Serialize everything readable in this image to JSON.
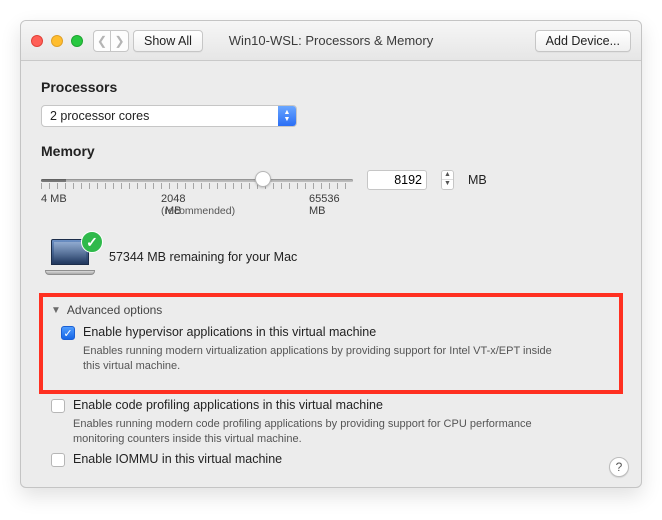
{
  "window": {
    "title": "Win10-WSL: Processors & Memory",
    "show_all_label": "Show All",
    "add_device_label": "Add Device..."
  },
  "processors": {
    "section_title": "Processors",
    "cores_value": "2  processor cores"
  },
  "memory": {
    "section_title": "Memory",
    "value": "8192",
    "unit": "MB",
    "min_label": "4 MB",
    "recommended_value": "2048 MB",
    "recommended_caption": "(recommended)",
    "max_label": "65536 MB",
    "remaining_text": "57344 MB remaining for your Mac",
    "knob_percent": 71
  },
  "advanced": {
    "heading": "Advanced options",
    "hypervisor": {
      "checked": true,
      "label": "Enable hypervisor applications in this virtual machine",
      "description": "Enables running modern virtualization applications by providing support for Intel VT-x/EPT inside this virtual machine."
    },
    "profiling": {
      "checked": false,
      "label": "Enable code profiling applications in this virtual machine",
      "description": "Enables running modern code profiling applications by providing support for CPU performance monitoring counters inside this virtual machine."
    },
    "iommu": {
      "checked": false,
      "label": "Enable IOMMU in this virtual machine"
    }
  },
  "help_label": "?"
}
